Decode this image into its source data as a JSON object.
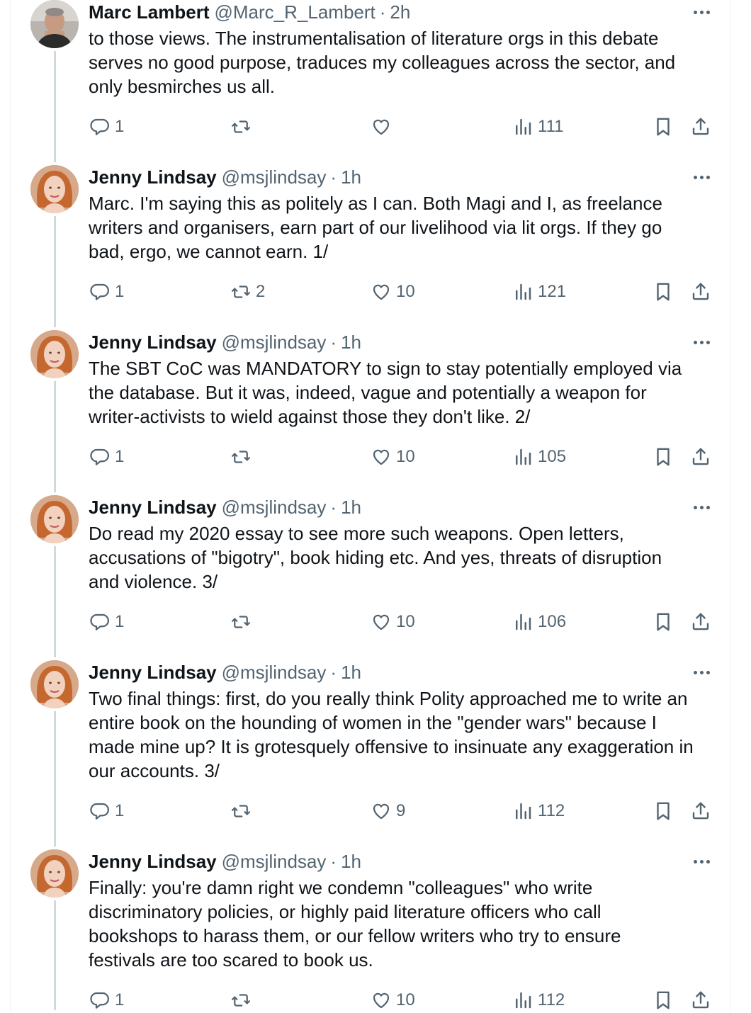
{
  "tweets": [
    {
      "name": "Marc Lambert",
      "handle": "@Marc_R_Lambert",
      "time": "2h",
      "avatar": "marc",
      "text": "to those views. The instrumentalisation of literature orgs in this debate\nserves no good purpose, traduces my colleagues across the sector, and\nonly besmirches us all.",
      "replies": "1",
      "retweets": "",
      "likes": "",
      "views": "111"
    },
    {
      "name": "Jenny Lindsay",
      "handle": "@msjlindsay",
      "time": "1h",
      "avatar": "jenny",
      "text": "Marc. I'm saying this as politely as I can. Both Magi and I, as freelance\nwriters and organisers, earn part of our livelihood via lit orgs. If they go\nbad, ergo, we cannot earn. 1/",
      "replies": "1",
      "retweets": "2",
      "likes": "10",
      "views": "121"
    },
    {
      "name": "Jenny Lindsay",
      "handle": "@msjlindsay",
      "time": "1h",
      "avatar": "jenny",
      "text": "The SBT CoC was MANDATORY to sign to stay potentially employed via\nthe database. But it was, indeed, vague and potentially a weapon for\nwriter-activists to wield against those they don't like. 2/",
      "replies": "1",
      "retweets": "",
      "likes": "10",
      "views": "105"
    },
    {
      "name": "Jenny Lindsay",
      "handle": "@msjlindsay",
      "time": "1h",
      "avatar": "jenny",
      "text": "Do read my 2020 essay to see more such weapons. Open letters,\naccusations of \"bigotry\", book hiding etc. And yes, threats of disruption\nand violence. 3/",
      "replies": "1",
      "retweets": "",
      "likes": "10",
      "views": "106"
    },
    {
      "name": "Jenny Lindsay",
      "handle": "@msjlindsay",
      "time": "1h",
      "avatar": "jenny",
      "text": "Two final things: first, do you really think Polity approached me to write an\nentire book on the hounding of women in the \"gender wars\" because I\nmade mine up? It is grotesquely offensive to insinuate any exaggeration in\nour accounts.  3/",
      "replies": "1",
      "retweets": "",
      "likes": "9",
      "views": "112"
    },
    {
      "name": "Jenny Lindsay",
      "handle": "@msjlindsay",
      "time": "1h",
      "avatar": "jenny",
      "text": "Finally: you're damn right we condemn \"colleagues\" who write\ndiscriminatory policies, or highly paid literature officers who call\nbookshops to harass them, or our fellow writers who try to ensure\nfestivals are too scared to book us.",
      "replies": "1",
      "retweets": "",
      "likes": "10",
      "views": "112"
    }
  ],
  "separator": "·",
  "icons": {
    "reply": "reply-icon",
    "retweet": "retweet-icon",
    "like": "heart-icon",
    "views": "views-chart-icon",
    "bookmark": "bookmark-icon",
    "share": "share-icon",
    "more": "more-dots-icon"
  },
  "colors": {
    "text": "#0f1419",
    "secondary": "#536471",
    "thread_line": "#cfd9de"
  }
}
